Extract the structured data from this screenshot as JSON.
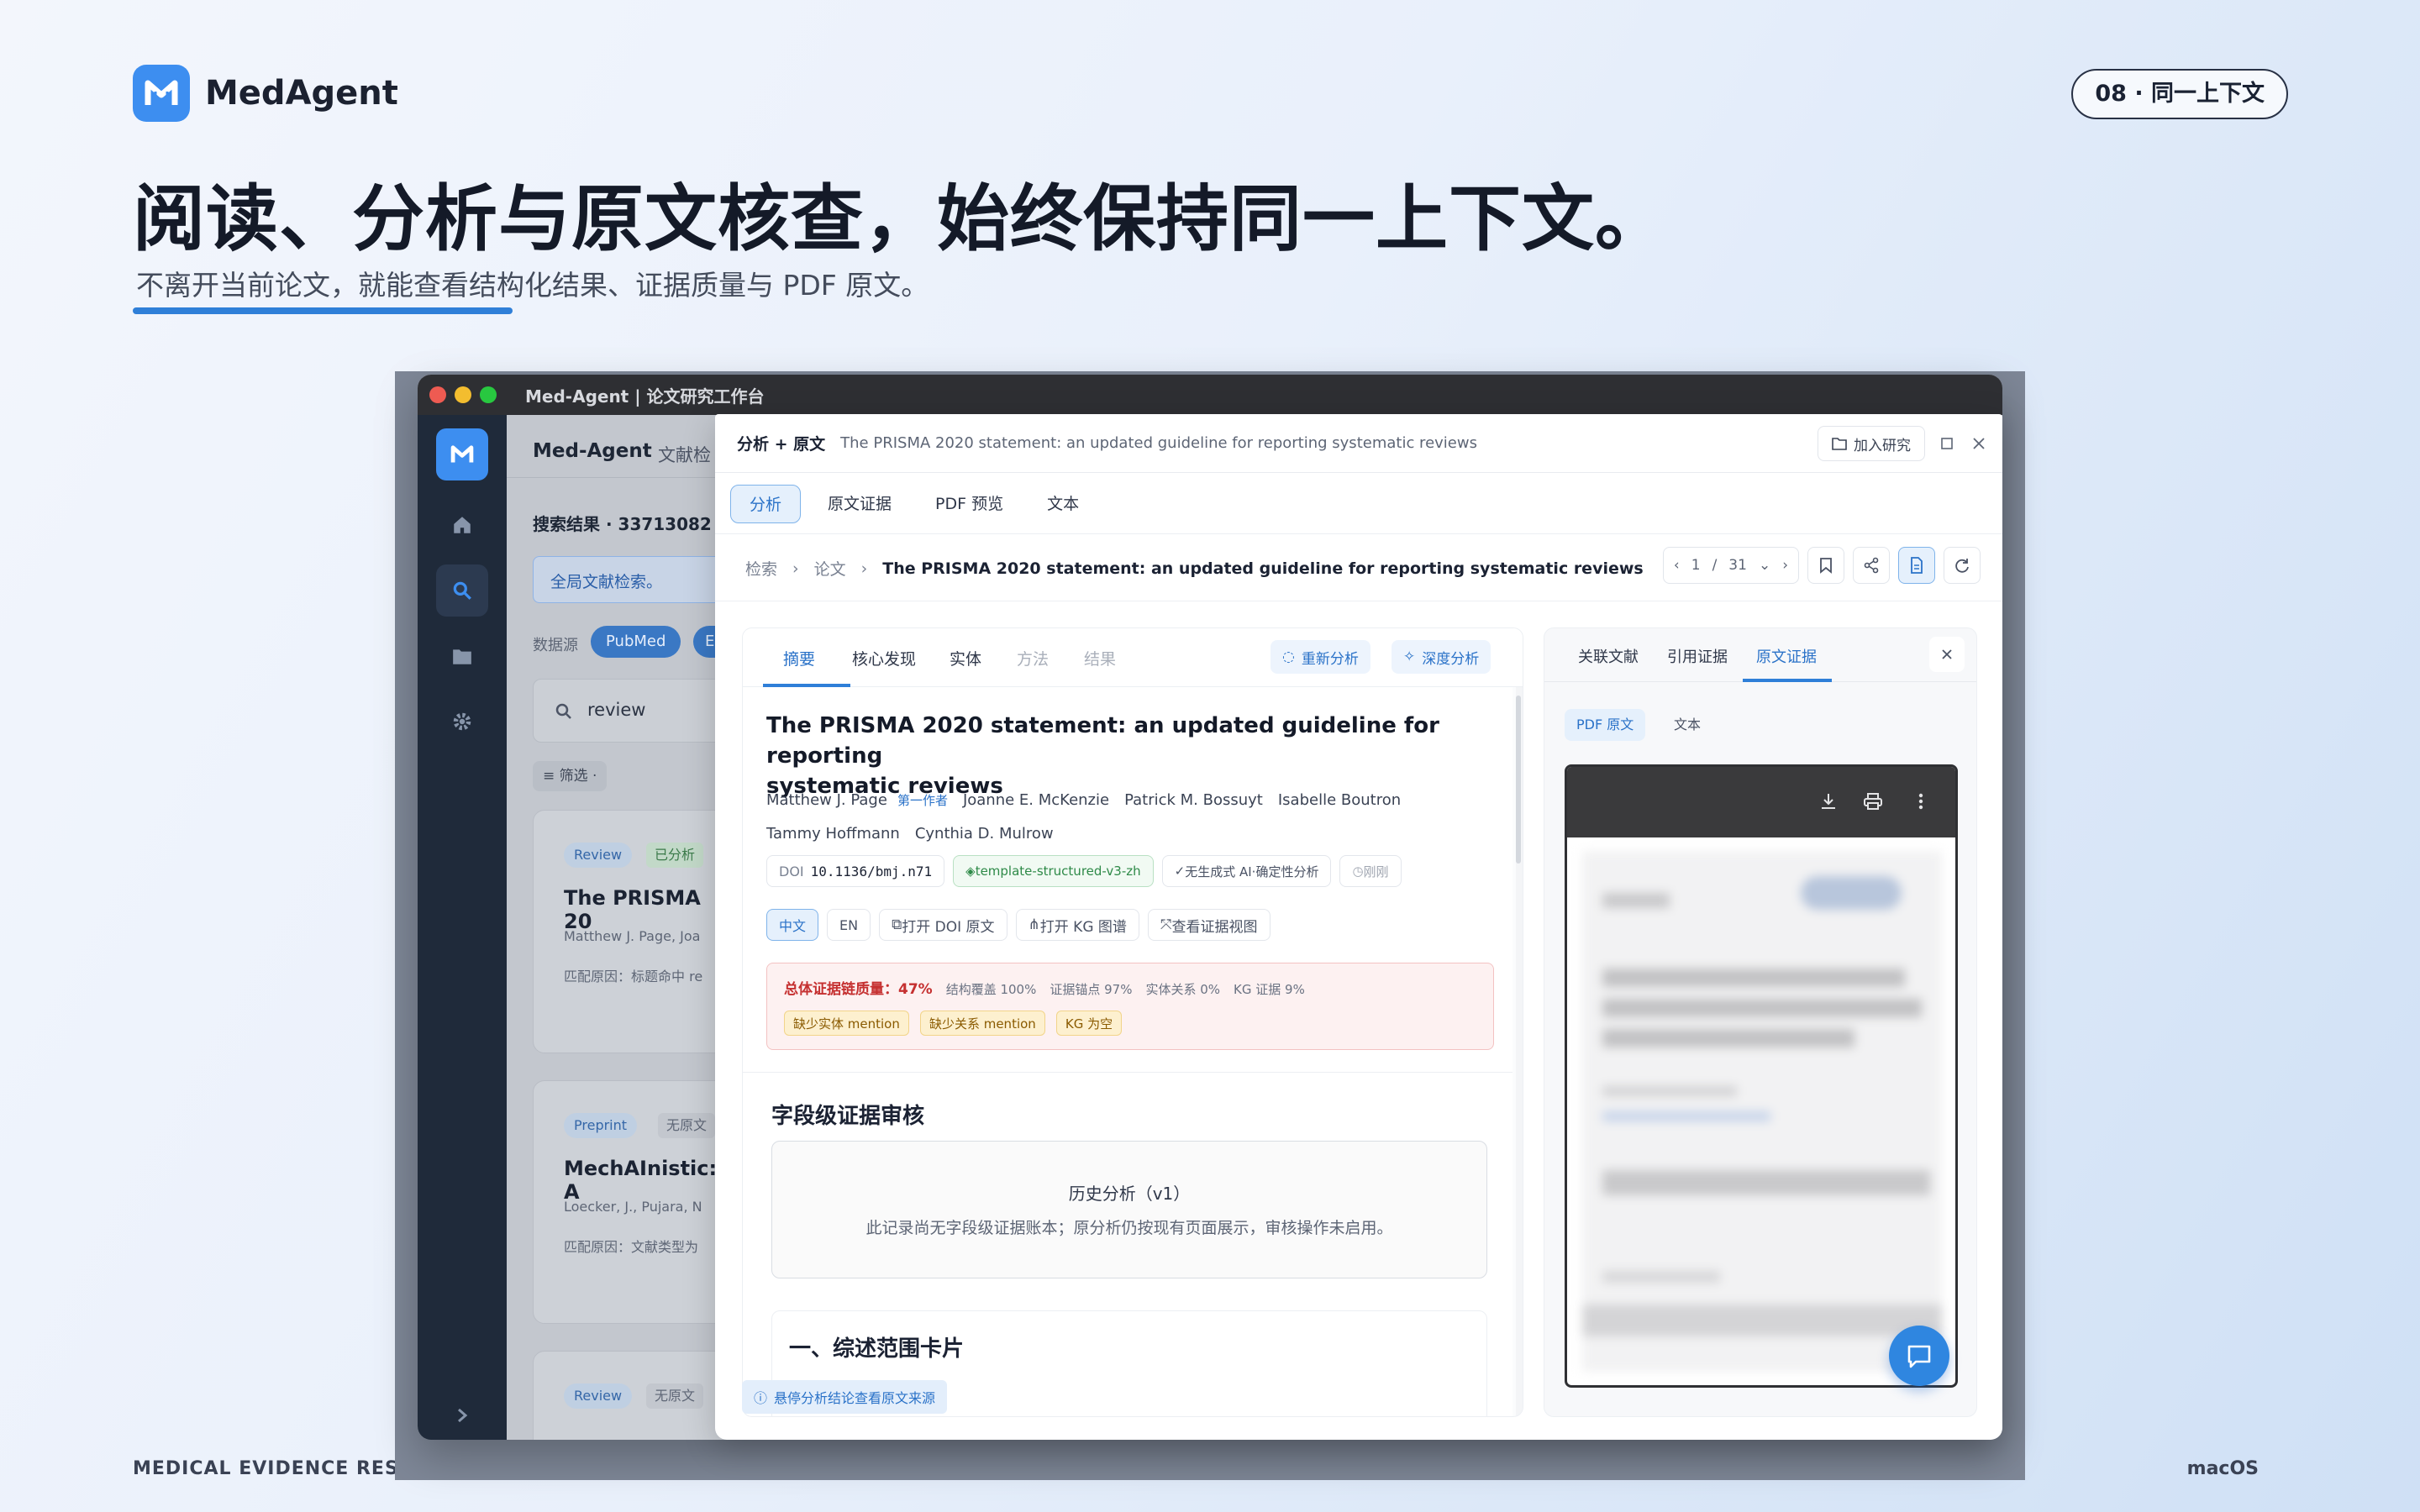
{
  "brand": {
    "name": "MedAgent"
  },
  "slide_tag": "08 · 同一上下文",
  "headline": "阅读、分析与原文核查，始终保持同一上下文。",
  "subheadline": "不离开当前论文，就能查看结构化结果、证据质量与 PDF 原文。",
  "footer": {
    "left": "MEDICAL EVIDENCE RESEARCH WORKSPACE",
    "right": "macOS"
  },
  "window": {
    "title": "Med-Agent | 论文研究工作台"
  },
  "bg": {
    "app_name": "Med-Agent",
    "tab_partial": "文献检",
    "results_label": "搜索结果 · 33713082 ",
    "global_search": "全局文献检索。",
    "datasource_label": "数据源",
    "datasource_pubmed": "PubMed",
    "datasource_other": "E",
    "search_value": "review",
    "filter_label": "筛选 ·",
    "cards": [
      {
        "badge1": "Review",
        "badge2": "已分析",
        "title": "The PRISMA 20",
        "authors": "Matthew J. Page, Joa",
        "reason": "匹配原因：标题命中 re"
      },
      {
        "badge1": "Preprint",
        "badge2": "无原文",
        "title": "MechAInistic: A",
        "authors": "Loecker, J., Pujara, N",
        "reason": "匹配原因：文献类型为"
      },
      {
        "badge1": "Review",
        "badge2": "无原文"
      }
    ]
  },
  "modal": {
    "title_label": "分析 + 原文",
    "paper_title": "The PRISMA 2020 statement: an updated guideline for reporting systematic reviews",
    "add_research": "加入研究",
    "tabs": [
      "分析",
      "原文证据",
      "PDF 预览",
      "文本"
    ],
    "breadcrumb": {
      "c1": "检索",
      "c2": "论文",
      "c3": "The PRISMA 2020 statement: an updated guideline for reporting systematic reviews"
    },
    "pager": {
      "current": "1",
      "sep": "/",
      "total": "31"
    },
    "analysis": {
      "subtabs": [
        "摘要",
        "核心发现",
        "实体",
        "方法",
        "结果"
      ],
      "reanalyze": "重新分析",
      "deep_analyze": "深度分析",
      "title_line1": "The PRISMA 2020 statement: an updated guideline for reporting",
      "title_line2": "systematic reviews",
      "authors_line1": [
        "Matthew J. Page",
        "Joanne E. McKenzie",
        "Patrick M. Bossuyt",
        "Isabelle Boutron"
      ],
      "first_author_badge": "第一作者",
      "authors_line2": [
        "Tammy Hoffmann",
        "Cynthia D. Mulrow"
      ],
      "doi_label": "DOI",
      "doi_value": "10.1136/bmj.n71",
      "template_tag": "template-structured-v3-zh",
      "ai_tag": "无生成式 AI·确定性分析",
      "time_tag": "刚刚",
      "lang_zh": "中文",
      "lang_en": "EN",
      "btn_doi": "打开 DOI 原文",
      "btn_kg": "打开 KG 图谱",
      "btn_evidence": "查看证据视图",
      "quality": {
        "label": "总体证据链质量：",
        "value": "47%",
        "metrics": [
          "结构覆盖 100%",
          "证据锚点 97%",
          "实体关系 0%",
          "KG 证据 9%"
        ],
        "chips": [
          "缺少实体 mention",
          "缺少关系 mention",
          "KG 为空"
        ]
      },
      "field_review_title": "字段级证据审核",
      "history_title": "历史分析（v1）",
      "history_desc": "此记录尚无字段级证据账本；原分析仍按现有页面展示，审核操作未启用。",
      "section1": "一、综述范围卡片",
      "hover_hint": "悬停分析结论查看原文来源"
    },
    "side": {
      "tabs": [
        "关联文献",
        "引用证据",
        "原文证据"
      ],
      "subtabs": [
        "PDF 原文",
        "文本"
      ]
    }
  },
  "colors": {
    "accent": "#2f7fd8",
    "brand": "#3d8ef0",
    "danger": "#d23a3a"
  }
}
